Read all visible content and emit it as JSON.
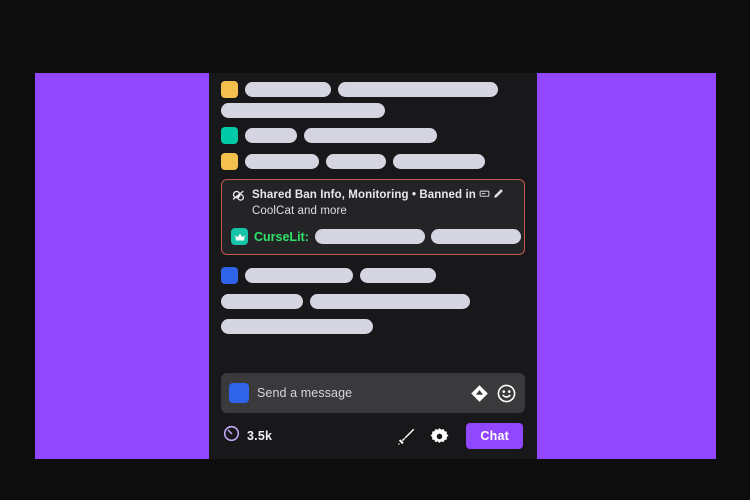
{
  "colors": {
    "page_background": "#0d0d0e",
    "stream_backdrop": "#9146ff",
    "chat_panel": "#18181b",
    "flagged_border": "#bf5a4d",
    "flagged_fill": "#242427",
    "username": "#2fe36a",
    "badge_curselit": "#16c5a8",
    "composer_fill": "#3a3a3d",
    "composer_badge": "#2f63e8",
    "chat_button": "#9147ff",
    "skeleton_bar": "#d4d5e0"
  },
  "chat": {
    "messages": [
      {
        "badge_color": "#f5c14e",
        "lines": [
          [
            86,
            160
          ],
          [
            164
          ]
        ]
      },
      {
        "badge_color": "#00c9a7",
        "lines": [
          [
            52,
            133
          ]
        ]
      },
      {
        "badge_color": "#f5c14e",
        "lines": [
          [
            74,
            60,
            92
          ]
        ]
      }
    ],
    "messages_after": [
      {
        "badge_color": "#2f63e8",
        "lines": [
          [
            108,
            76
          ],
          [
            82,
            160
          ],
          [
            152
          ]
        ]
      }
    ]
  },
  "flagged_message": {
    "icon": "shared-ban-info-icon",
    "header_title": "Shared Ban Info, Monitoring",
    "header_separator": " • ",
    "header_status": "Banned in",
    "header_icons": [
      "card-icon",
      "pen-icon"
    ],
    "header_subtitle": "CoolCat and more",
    "badge": "crown-icon",
    "username": "CurseLit:",
    "body_bars": [
      110,
      90
    ]
  },
  "composer": {
    "badge": "emote-badge-icon",
    "placeholder": "Send a message",
    "icons": [
      "gem-icon",
      "emoji-icon"
    ]
  },
  "actionbar": {
    "viewers_icon": "viewer-count-icon",
    "viewer_count": "3.5k",
    "icons": [
      "sword-icon",
      "gear-icon"
    ],
    "chat_label": "Chat"
  }
}
